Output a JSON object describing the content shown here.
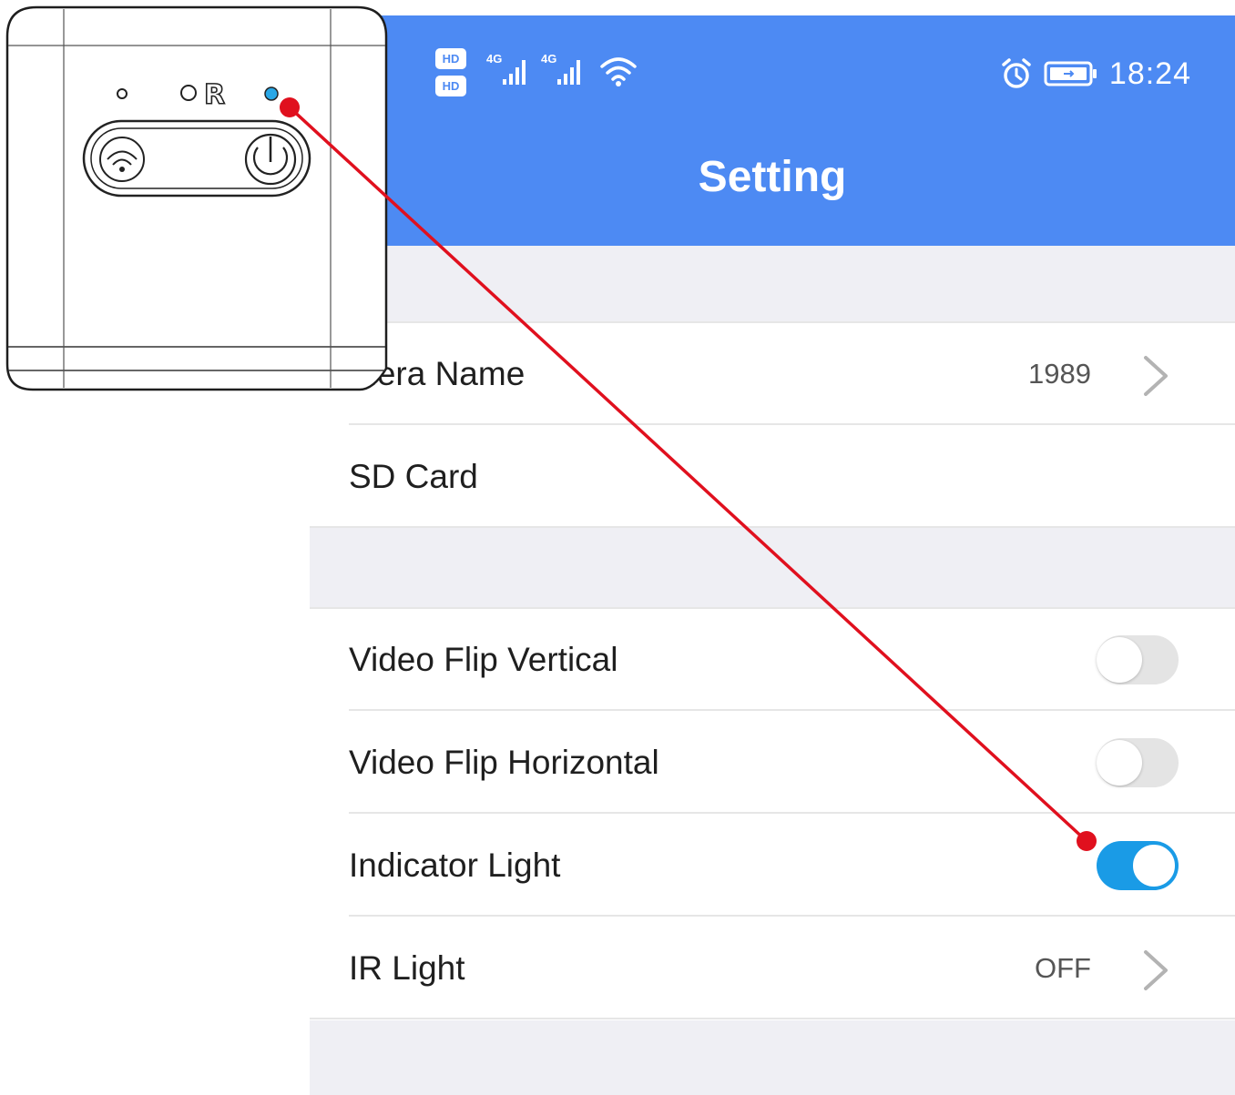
{
  "status_bar": {
    "hd_badge_top": "HD",
    "hd_badge_bottom": "HD",
    "signal_1": "4G",
    "signal_2": "4G",
    "time": "18:24",
    "icons": [
      "hd-icon",
      "signal-icon",
      "wifi-icon",
      "alarm-icon",
      "battery-icon"
    ]
  },
  "header": {
    "title": "Setting"
  },
  "settings": {
    "camera_name": {
      "label": "mera Name",
      "value": "1989"
    },
    "sd_card": {
      "label": "SD Card"
    },
    "video_flip_vertical": {
      "label": "Video Flip Vertical",
      "enabled": false
    },
    "video_flip_horizontal": {
      "label": "Video Flip Horizontal",
      "enabled": false
    },
    "indicator_light": {
      "label": "Indicator Light",
      "enabled": true
    },
    "ir_light": {
      "label": "IR Light",
      "value": "OFF"
    }
  },
  "camera_sketch": {
    "reset_label": "R"
  },
  "colors": {
    "header_blue": "#4d8af3",
    "toggle_on": "#1a9be6",
    "annotation_red": "#e0101e",
    "led_blue": "#29a7e6",
    "section_gap": "#efeff4"
  }
}
